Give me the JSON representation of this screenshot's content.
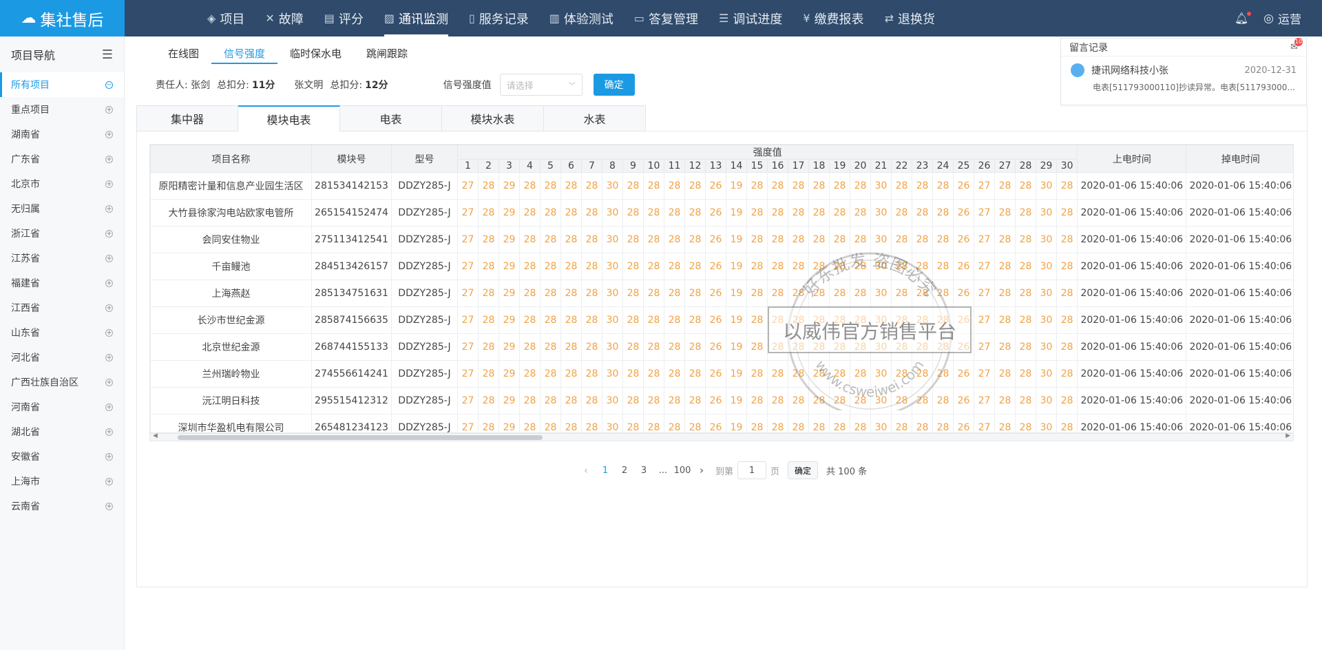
{
  "brand": {
    "logo_text": "集社售后"
  },
  "topnav": [
    {
      "label": "项目",
      "icon": "layers-icon"
    },
    {
      "label": "故障",
      "icon": "tools-icon"
    },
    {
      "label": "评分",
      "icon": "clipboard-icon"
    },
    {
      "label": "通讯监测",
      "icon": "chart-icon",
      "active": true
    },
    {
      "label": "服务记录",
      "icon": "document-icon"
    },
    {
      "label": "体验测试",
      "icon": "bar-icon"
    },
    {
      "label": "答复管理",
      "icon": "message-icon"
    },
    {
      "label": "调试进度",
      "icon": "list-icon"
    },
    {
      "label": "缴费报表",
      "icon": "yen-icon"
    },
    {
      "label": "退换货",
      "icon": "return-icon"
    }
  ],
  "user": {
    "label": "运营"
  },
  "sidebar": {
    "title": "项目导航",
    "items": [
      {
        "label": "所有项目",
        "active": true
      },
      {
        "label": "重点项目"
      },
      {
        "label": "湖南省"
      },
      {
        "label": "广东省"
      },
      {
        "label": "北京市"
      },
      {
        "label": "无归属"
      },
      {
        "label": "浙江省"
      },
      {
        "label": "江苏省"
      },
      {
        "label": "福建省"
      },
      {
        "label": "江西省"
      },
      {
        "label": "山东省"
      },
      {
        "label": "河北省"
      },
      {
        "label": "广西壮族自治区"
      },
      {
        "label": "河南省"
      },
      {
        "label": "湖北省"
      },
      {
        "label": "安徽省"
      },
      {
        "label": "上海市"
      },
      {
        "label": "云南省"
      }
    ]
  },
  "subtabs": [
    {
      "label": "在线图"
    },
    {
      "label": "信号强度",
      "active": true
    },
    {
      "label": "临时保水电"
    },
    {
      "label": "跳闸跟踪"
    }
  ],
  "info": {
    "owner_label": "责任人: 张剑",
    "score_label1": "总扣分:",
    "score1": "11分",
    "person2": "张文明",
    "score_label2": "总扣分:",
    "score2": "12分",
    "signal_label": "信号强度值",
    "select_placeholder": "请选择",
    "confirm": "确定"
  },
  "messages": {
    "title": "留言记录",
    "badge": "10",
    "items": [
      {
        "name": "捷讯网络科技小张",
        "date": "2020-12-31",
        "text": "电表[511793000110]抄读异常。电表[511793000..."
      }
    ]
  },
  "devicetabs": [
    {
      "label": "集中器"
    },
    {
      "label": "模块电表",
      "active": true
    },
    {
      "label": "电表"
    },
    {
      "label": "模块水表"
    },
    {
      "label": "水表"
    }
  ],
  "table": {
    "headers": {
      "name": "项目名称",
      "module": "模块号",
      "model": "型号",
      "strength": "强度值",
      "power_on": "上电时间",
      "power_off": "掉电时间"
    },
    "strength_cols": [
      "1",
      "2",
      "3",
      "4",
      "5",
      "6",
      "7",
      "8",
      "9",
      "10",
      "11",
      "12",
      "13",
      "14",
      "15",
      "16",
      "17",
      "18",
      "19",
      "20",
      "21",
      "22",
      "23",
      "24",
      "25",
      "26",
      "27",
      "28",
      "29",
      "30"
    ],
    "rows": [
      {
        "name": "原阳精密计量和信息产业园生活区",
        "module": "281534142153",
        "model": "DDZY285-J",
        "values": [
          "27",
          "28",
          "29",
          "28",
          "28",
          "28",
          "28",
          "30",
          "28",
          "28",
          "28",
          "28",
          "26",
          "19",
          "28",
          "28",
          "28",
          "28",
          "28",
          "28",
          "30",
          "28",
          "28",
          "28",
          "26",
          "27",
          "28",
          "28",
          "30",
          "28"
        ],
        "on": "2020-01-06 15:40:06",
        "off": "2020-01-06 15:40:06"
      },
      {
        "name": "大竹县徐家沟电站欧家电管所",
        "module": "265154152474",
        "model": "DDZY285-J",
        "values": [
          "27",
          "28",
          "29",
          "28",
          "28",
          "28",
          "28",
          "30",
          "28",
          "28",
          "28",
          "28",
          "26",
          "19",
          "28",
          "28",
          "28",
          "28",
          "28",
          "28",
          "30",
          "28",
          "28",
          "28",
          "26",
          "27",
          "28",
          "28",
          "30",
          "28"
        ],
        "on": "2020-01-06 15:40:06",
        "off": "2020-01-06 15:40:06"
      },
      {
        "name": "会同安住物业",
        "module": "275113412541",
        "model": "DDZY285-J",
        "values": [
          "27",
          "28",
          "29",
          "28",
          "28",
          "28",
          "28",
          "30",
          "28",
          "28",
          "28",
          "28",
          "26",
          "19",
          "28",
          "28",
          "28",
          "28",
          "28",
          "28",
          "30",
          "28",
          "28",
          "28",
          "26",
          "27",
          "28",
          "28",
          "30",
          "28"
        ],
        "on": "2020-01-06 15:40:06",
        "off": "2020-01-06 15:40:06"
      },
      {
        "name": "千亩鳗池",
        "module": "284513426157",
        "model": "DDZY285-J",
        "values": [
          "27",
          "28",
          "29",
          "28",
          "28",
          "28",
          "28",
          "30",
          "28",
          "28",
          "28",
          "28",
          "26",
          "19",
          "28",
          "28",
          "28",
          "28",
          "28",
          "28",
          "30",
          "28",
          "28",
          "28",
          "26",
          "27",
          "28",
          "28",
          "30",
          "28"
        ],
        "on": "2020-01-06 15:40:06",
        "off": "2020-01-06 15:40:06"
      },
      {
        "name": "上海燕赵",
        "module": "285134751631",
        "model": "DDZY285-J",
        "values": [
          "27",
          "28",
          "29",
          "28",
          "28",
          "28",
          "28",
          "30",
          "28",
          "28",
          "28",
          "28",
          "26",
          "19",
          "28",
          "28",
          "28",
          "28",
          "28",
          "28",
          "30",
          "28",
          "28",
          "28",
          "26",
          "27",
          "28",
          "28",
          "30",
          "28"
        ],
        "on": "2020-01-06 15:40:06",
        "off": "2020-01-06 15:40:06"
      },
      {
        "name": "长沙市世纪金源",
        "module": "285874156635",
        "model": "DDZY285-J",
        "values": [
          "27",
          "28",
          "29",
          "28",
          "28",
          "28",
          "28",
          "30",
          "28",
          "28",
          "28",
          "28",
          "26",
          "19",
          "28",
          "28",
          "28",
          "28",
          "28",
          "28",
          "30",
          "28",
          "28",
          "28",
          "26",
          "27",
          "28",
          "28",
          "30",
          "28"
        ],
        "on": "2020-01-06 15:40:06",
        "off": "2020-01-06 15:40:06"
      },
      {
        "name": "北京世纪金源",
        "module": "268744155133",
        "model": "DDZY285-J",
        "values": [
          "27",
          "28",
          "29",
          "28",
          "28",
          "28",
          "28",
          "30",
          "28",
          "28",
          "28",
          "28",
          "26",
          "19",
          "28",
          "28",
          "28",
          "28",
          "28",
          "28",
          "30",
          "28",
          "28",
          "28",
          "26",
          "27",
          "28",
          "28",
          "30",
          "28"
        ],
        "on": "2020-01-06 15:40:06",
        "off": "2020-01-06 15:40:06"
      },
      {
        "name": "兰州瑞岭物业",
        "module": "274556614241",
        "model": "DDZY285-J",
        "values": [
          "27",
          "28",
          "29",
          "28",
          "28",
          "28",
          "28",
          "30",
          "28",
          "28",
          "28",
          "28",
          "26",
          "19",
          "28",
          "28",
          "28",
          "28",
          "28",
          "28",
          "30",
          "28",
          "28",
          "28",
          "26",
          "27",
          "28",
          "28",
          "30",
          "28"
        ],
        "on": "2020-01-06 15:40:06",
        "off": "2020-01-06 15:40:06"
      },
      {
        "name": "沅江明日科技",
        "module": "295515412312",
        "model": "DDZY285-J",
        "values": [
          "27",
          "28",
          "29",
          "28",
          "28",
          "28",
          "28",
          "30",
          "28",
          "28",
          "28",
          "28",
          "26",
          "19",
          "28",
          "28",
          "28",
          "28",
          "28",
          "28",
          "30",
          "28",
          "28",
          "28",
          "26",
          "27",
          "28",
          "28",
          "30",
          "28"
        ],
        "on": "2020-01-06 15:40:06",
        "off": "2020-01-06 15:40:06"
      },
      {
        "name": "深圳市华盈机电有限公司",
        "module": "265481234123",
        "model": "DDZY285-J",
        "values": [
          "27",
          "28",
          "29",
          "28",
          "28",
          "28",
          "28",
          "30",
          "28",
          "28",
          "28",
          "28",
          "26",
          "19",
          "28",
          "28",
          "28",
          "28",
          "28",
          "28",
          "30",
          "28",
          "28",
          "28",
          "26",
          "27",
          "28",
          "28",
          "30",
          "28"
        ],
        "on": "2020-01-06 15:40:06",
        "off": "2020-01-06 15:40:06"
      }
    ]
  },
  "pagination": {
    "pages": [
      "1",
      "2",
      "3",
      "...",
      "100"
    ],
    "current": "1",
    "goto_label": "到第",
    "page_value": "1",
    "page_unit": "页",
    "go": "确定",
    "total": "共 100 条"
  },
  "watermark": {
    "main": "以威伟官方销售平台",
    "arc_top": "好东批发 盗图必究",
    "arc_bottom": "www.csweiwei.com"
  },
  "colors": {
    "brand": "#1b9ae3",
    "topbar": "#2f4a6b",
    "value": "#f0a245"
  }
}
